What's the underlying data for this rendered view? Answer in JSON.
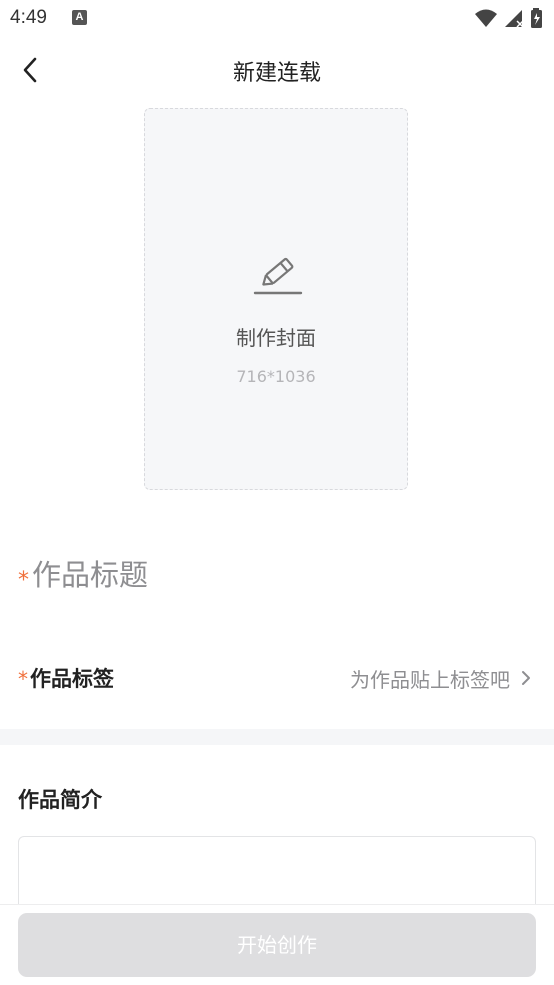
{
  "status_bar": {
    "time": "4:49",
    "notification_icon": "A"
  },
  "header": {
    "title": "新建连载"
  },
  "cover": {
    "label": "制作封面",
    "size_hint": "716*1036"
  },
  "title_field": {
    "required_mark": "*",
    "placeholder": "作品标题"
  },
  "tags_field": {
    "required_mark": "*",
    "label": "作品标签",
    "hint": "为作品贴上标签吧"
  },
  "intro_field": {
    "label": "作品简介",
    "value": ""
  },
  "footer": {
    "start_button": "开始创作"
  },
  "colors": {
    "required": "#f0703c",
    "button_disabled": "#dedee0",
    "cover_bg": "#f6f7f9"
  },
  "icons": [
    "back-arrow-icon",
    "pencil-icon",
    "chevron-right-icon",
    "wifi-icon",
    "signal-icon",
    "battery-icon"
  ]
}
